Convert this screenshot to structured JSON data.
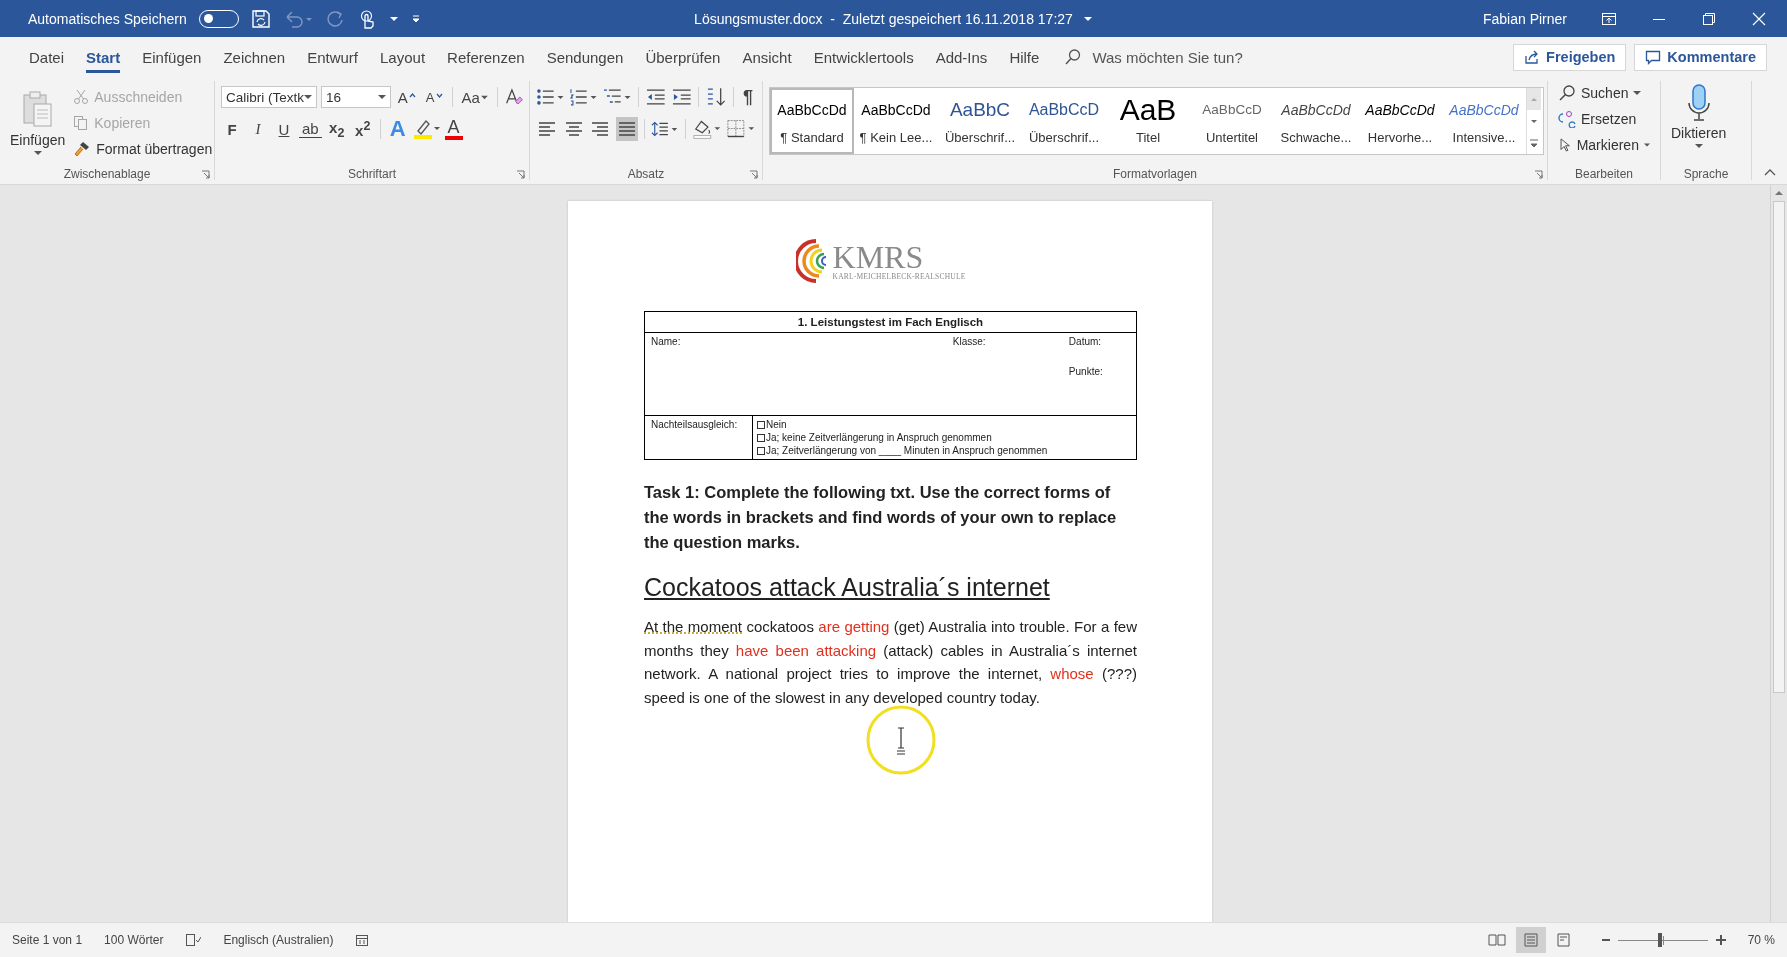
{
  "title_bar": {
    "autosave_label": "Automatisches Speichern",
    "autosave_on": false,
    "document_title": "Lösungsmuster.docx  -  Zuletzt gespeichert 16.11.2018 17:27",
    "user": "Fabian Pirner"
  },
  "menu_tabs": [
    {
      "label": "Datei",
      "selected": false
    },
    {
      "label": "Start",
      "selected": true
    },
    {
      "label": "Einfügen",
      "selected": false
    },
    {
      "label": "Zeichnen",
      "selected": false
    },
    {
      "label": "Entwurf",
      "selected": false
    },
    {
      "label": "Layout",
      "selected": false
    },
    {
      "label": "Referenzen",
      "selected": false
    },
    {
      "label": "Sendungen",
      "selected": false
    },
    {
      "label": "Überprüfen",
      "selected": false
    },
    {
      "label": "Ansicht",
      "selected": false
    },
    {
      "label": "Entwicklertools",
      "selected": false
    },
    {
      "label": "Add-Ins",
      "selected": false
    },
    {
      "label": "Hilfe",
      "selected": false
    }
  ],
  "tell_me": {
    "placeholder": "Was möchten Sie tun?"
  },
  "share_button": "Freigeben",
  "comments_button": "Kommentare",
  "clipboard": {
    "title": "Zwischenablage",
    "paste": "Einfügen",
    "items": [
      {
        "label": "Ausschneiden",
        "kind": "cut",
        "disabled": true
      },
      {
        "label": "Kopieren",
        "kind": "copy",
        "disabled": true
      },
      {
        "label": "Format übertragen",
        "kind": "painter",
        "disabled": false
      }
    ]
  },
  "font": {
    "title": "Schriftart",
    "name": "Calibri (Textk",
    "size": "16",
    "grow": "A",
    "shrink": "A",
    "case": "Aa",
    "effects": "A",
    "font_color_label": "A",
    "styles": [
      {
        "label": "F",
        "kind": "bold"
      },
      {
        "label": "I",
        "kind": "italic"
      },
      {
        "label": "U",
        "kind": "underline"
      },
      {
        "label": "ab",
        "kind": "strike"
      },
      {
        "label": "x$_{2}$",
        "kind": "sub"
      },
      {
        "label": "x$^{2}$",
        "kind": "sup"
      }
    ]
  },
  "paragraph": {
    "title": "Absatz",
    "marks": "¶",
    "alignments": [
      {
        "kind": "left",
        "selected": false
      },
      {
        "kind": "center",
        "selected": false
      },
      {
        "kind": "right",
        "selected": false
      },
      {
        "kind": "justify",
        "selected": true
      }
    ]
  },
  "styles": {
    "title": "Formatvorlagen",
    "items": [
      {
        "preview": "AaBbCcDd",
        "name": "¶ Standard",
        "kind": "normal",
        "selected": true
      },
      {
        "preview": "AaBbCcDd",
        "name": "¶ Kein Lee...",
        "kind": "nospacing",
        "selected": false
      },
      {
        "preview": "AaBbC",
        "name": "Überschrif...",
        "kind": "heading1",
        "selected": false
      },
      {
        "preview": "AaBbCcD",
        "name": "Überschrif...",
        "kind": "heading2",
        "selected": false
      },
      {
        "preview": "AaB",
        "name": "Titel",
        "kind": "title",
        "selected": false
      },
      {
        "preview": "AaBbCcD",
        "name": "Untertitel",
        "kind": "subtitle",
        "selected": false
      },
      {
        "preview": "AaBbCcDd",
        "name": "Schwache...",
        "kind": "subtle",
        "selected": false
      },
      {
        "preview": "AaBbCcDd",
        "name": "Hervorhe...",
        "kind": "emphasis",
        "selected": false
      },
      {
        "preview": "AaBbCcDd",
        "name": "Intensive...",
        "kind": "intense",
        "selected": false
      }
    ]
  },
  "editing": {
    "title": "Bearbeiten",
    "items": [
      {
        "label": "Suchen",
        "kind": "find",
        "dropdown": true
      },
      {
        "label": "Ersetzen",
        "kind": "replace",
        "dropdown": false
      },
      {
        "label": "Markieren",
        "kind": "select",
        "dropdown": true
      }
    ]
  },
  "voice": {
    "title": "Sprache",
    "dictate": "Diktieren"
  },
  "document": {
    "logo": {
      "name": "KMRS",
      "subtitle": "KARL-MEICHELBECK-REALSCHULE"
    },
    "header_table": {
      "title": "1. Leistungstest im Fach Englisch",
      "name_label": "Name:",
      "class_label": "Klasse:",
      "date_label": "Datum:",
      "points_label": "Punkte:",
      "compensation_label": "Nachteilsausgleich:",
      "options": [
        {
          "label": "Nein",
          "checked": false
        },
        {
          "label": "Ja; keine Zeitverlängerung in Anspruch genommen",
          "checked": false
        },
        {
          "label": "Ja; Zeitverlängerung von ____ Minuten in Anspruch genommen",
          "checked": false
        }
      ]
    },
    "task": "Task 1: Complete the following txt. Use the correct forms of the words in brackets and find words of your own to replace the question marks.",
    "heading": "Cockatoos attack Australia´s internet",
    "body": [
      {
        "text": "At the moment",
        "answer": false,
        "flagged": true
      },
      {
        "text": " cockatoos ",
        "answer": false,
        "flagged": false
      },
      {
        "text": "are getting",
        "answer": true,
        "flagged": false
      },
      {
        "text": " (get) Australia into trouble. For a few months they ",
        "answer": false,
        "flagged": false
      },
      {
        "text": "have been attacking",
        "answer": true,
        "flagged": false
      },
      {
        "text": " (attack) cables in Australia´s internet network. A national project tries to improve the internet, ",
        "answer": false,
        "flagged": false
      },
      {
        "text": "whose",
        "answer": true,
        "flagged": false
      },
      {
        "text": " (???) speed is one of the slowest in any developed country today.",
        "answer": false,
        "flagged": false
      }
    ]
  },
  "status_bar": {
    "page": "Seite 1 von 1",
    "words": "100 Wörter",
    "language": "Englisch (Australien)",
    "views": [
      {
        "kind": "read",
        "selected": false
      },
      {
        "kind": "print",
        "selected": true
      },
      {
        "kind": "web",
        "selected": false
      }
    ],
    "zoom": {
      "level": 0.47,
      "label": "70 %"
    }
  }
}
